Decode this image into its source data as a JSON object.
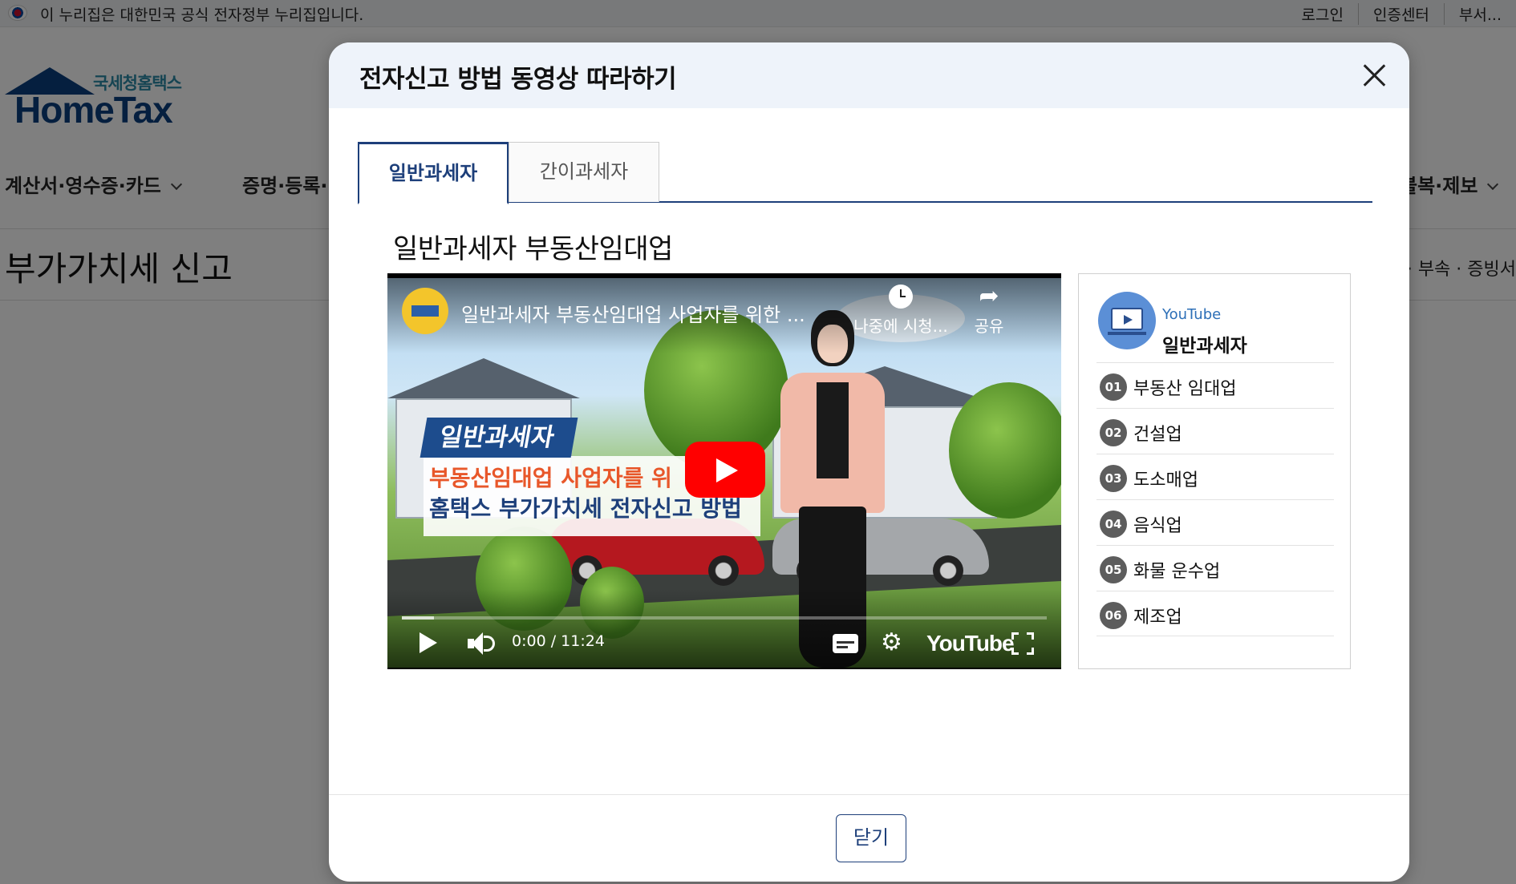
{
  "gov_bar": {
    "notice": "이 누리집은 대한민국 공식 전자정부 누리집입니다.",
    "links": [
      "로그인",
      "인증센터",
      "부서..."
    ]
  },
  "logo": {
    "subtitle": "국세청홈택스",
    "name": "HomeTax"
  },
  "gnb": {
    "items": [
      "계산서·영수증·카드",
      "증명·등록·",
      "불복·제보"
    ]
  },
  "page": {
    "title": "부가가치세 신고",
    "breadcrumb_right": "· 부속 · 증빙서"
  },
  "modal": {
    "title": "전자신고 방법 동영상 따라하기",
    "tabs": [
      {
        "label": "일반과세자",
        "active": true
      },
      {
        "label": "간이과세자",
        "active": false
      }
    ],
    "section_title": "일반과세자 부동산임대업",
    "close_button": "닫기"
  },
  "video": {
    "title": "일반과세자 부동산임대업 사업자를 위한 ...",
    "watch_later": "나중에 시청...",
    "share": "공유",
    "banner_badge": "일반과세자",
    "banner_line1": "부동산임대업 사업자를 위",
    "banner_line2": "홈택스 부가가치세 전자신고 방법",
    "time": "0:00 / 11:24",
    "brand": "YouTube",
    "progress_fraction": 0.05
  },
  "side_panel": {
    "source": "YouTube",
    "title": "일반과세자",
    "items": [
      {
        "num": "01",
        "label": "부동산 임대업"
      },
      {
        "num": "02",
        "label": "건설업"
      },
      {
        "num": "03",
        "label": "도소매업"
      },
      {
        "num": "04",
        "label": "음식업"
      },
      {
        "num": "05",
        "label": "화물 운수업"
      },
      {
        "num": "06",
        "label": "제조업"
      }
    ]
  },
  "colors": {
    "accent": "#1d3f7a",
    "header_bg": "#eef3fa",
    "youtube_red": "#ff0000"
  },
  "icons": [
    "close-icon",
    "play-icon",
    "volume-icon",
    "captions-icon",
    "settings-gear-icon",
    "fullscreen-icon",
    "clock-icon",
    "share-icon",
    "youtube-video-icon"
  ]
}
